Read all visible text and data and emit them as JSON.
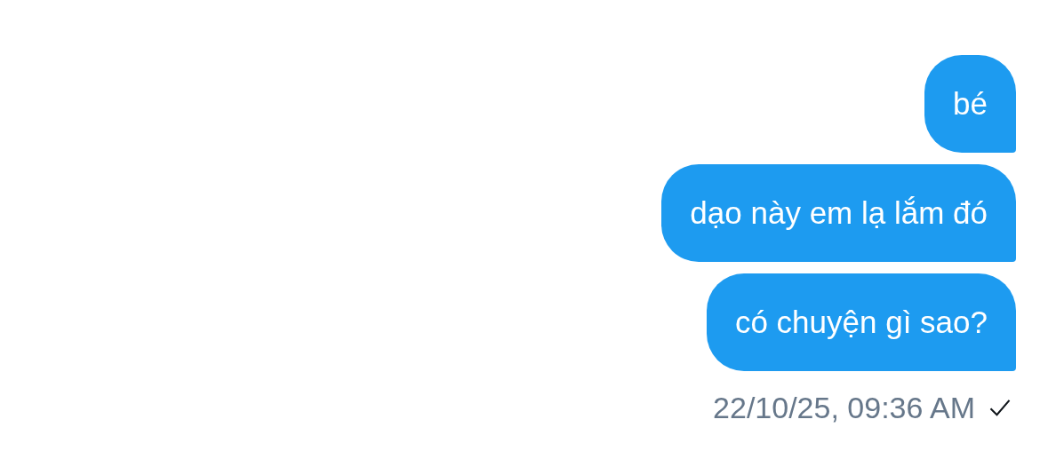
{
  "messages": [
    {
      "text": "bé"
    },
    {
      "text": "dạo này em lạ lắm đó"
    },
    {
      "text": "có chuyện gì sao?"
    }
  ],
  "timestamp": "22/10/25, 09:36 AM",
  "delivered": true
}
